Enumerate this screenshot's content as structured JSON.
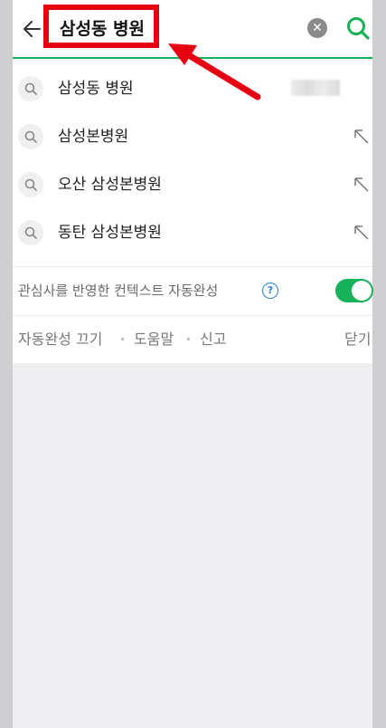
{
  "header": {
    "back_icon": "arrow-left-icon",
    "query": "삼성동 병원",
    "clear_icon": "clear-x-icon",
    "search_icon": "search-magnifier-icon"
  },
  "suggestions": [
    {
      "label": "삼성동 병원",
      "icon": "search-icon",
      "action": "blurred"
    },
    {
      "label": "삼성본병원",
      "icon": "search-icon",
      "action": "fill-arrow-icon"
    },
    {
      "label": "오산 삼성본병원",
      "icon": "search-icon",
      "action": "fill-arrow-icon"
    },
    {
      "label": "동탄 삼성본병원",
      "icon": "search-icon",
      "action": "fill-arrow-icon"
    }
  ],
  "context": {
    "label": "관심사를 반영한 컨텍스트 자동완성",
    "help": "?",
    "toggle_on": true
  },
  "footer": {
    "autocomplete_off": "자동완성 끄기",
    "help": "도움말",
    "report": "신고",
    "close": "닫기"
  },
  "colors": {
    "accent_green": "#19b05a",
    "annotation_red": "#e60012",
    "help_blue": "#2b7fd3"
  }
}
